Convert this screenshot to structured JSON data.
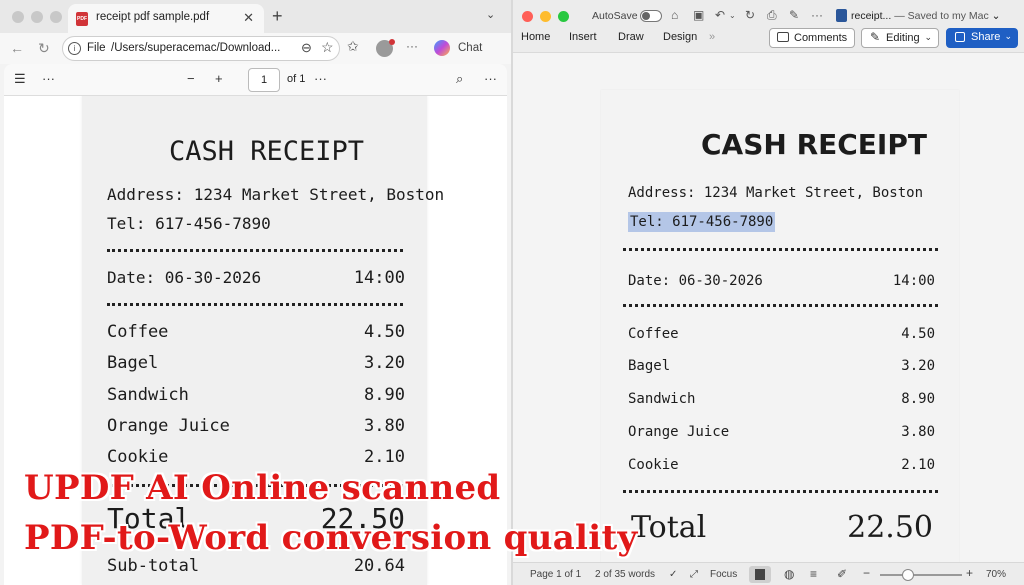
{
  "browser": {
    "tab_title": "receipt pdf sample.pdf",
    "tab_icon_text": "PDF",
    "url_scheme": "File",
    "url_path": "/Users/superacemac/Download...",
    "chat_label": "Chat",
    "pdf_toolbar": {
      "zoom_out": "−",
      "zoom_in": "+",
      "page_current": "1",
      "page_total": "of 1"
    }
  },
  "receipt_left": {
    "title": "CASH RECEIPT",
    "address": "Address: 1234 Market Street, Boston",
    "tel": "Tel: 617-456-7890",
    "date": "Date: 06-30-2026",
    "time": "14:00",
    "items": [
      {
        "name": "Coffee",
        "price": "4.50"
      },
      {
        "name": "Bagel",
        "price": "3.20"
      },
      {
        "name": "Sandwich",
        "price": "8.90"
      },
      {
        "name": "Orange Juice",
        "price": "3.80"
      },
      {
        "name": "Cookie",
        "price": "2.10"
      }
    ],
    "total_label": "Total",
    "total_value": "22.50",
    "subtotal_label": "Sub-total",
    "subtotal_value": "20.64"
  },
  "word": {
    "autosave_label": "AutoSave",
    "doc_title": "receipt...",
    "doc_saved": "— Saved to my Mac",
    "ribbon_tabs": [
      "Home",
      "Insert",
      "Draw",
      "Design"
    ],
    "comments_label": "Comments",
    "editing_label": "Editing",
    "share_label": "Share",
    "status": {
      "page": "Page 1 of 1",
      "words": "2 of 35 words",
      "focus": "Focus",
      "zoom": "70%"
    },
    "zoom_level": 0.7
  },
  "receipt_right": {
    "title": "CASH RECEIPT",
    "address": "Address: 1234 Market Street, Boston",
    "tel": "Tel: 617-456-7890",
    "date": "Date: 06-30-2026",
    "time": "14:00",
    "items": [
      {
        "name": "Coffee",
        "price": "4.50"
      },
      {
        "name": "Bagel",
        "price": "3.20"
      },
      {
        "name": "Sandwich",
        "price": "8.90"
      },
      {
        "name": "Orange Juice",
        "price": "3.80"
      },
      {
        "name": "Cookie",
        "price": "2.10"
      }
    ],
    "total_label": "Total",
    "total_value": "22.50"
  },
  "caption": {
    "line1": "UPDF AI Online scanned",
    "line2": "PDF-to-Word conversion quality"
  },
  "colors": {
    "caption_red": "#e11919",
    "share_blue": "#1f5fc4",
    "selection_highlight": "#b4c6e7"
  }
}
